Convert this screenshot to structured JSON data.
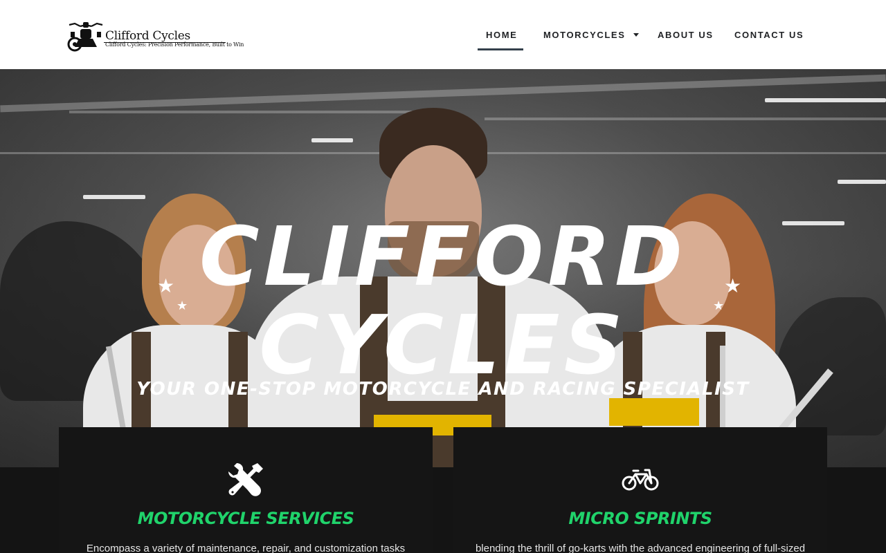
{
  "brand": {
    "logo_title": "Clifford Cycles",
    "logo_tagline": "Clifford Cycles: Precision Performance, Built to Win"
  },
  "nav": {
    "items": [
      {
        "label": "HOME",
        "active": true
      },
      {
        "label": "MOTORCYCLES",
        "has_dropdown": true
      },
      {
        "label": "ABOUT US"
      },
      {
        "label": "CONTACT US"
      }
    ]
  },
  "hero": {
    "title_line1": "CLIFFORD",
    "title_line2": "CYCLES",
    "subtitle": "YOUR ONE-STOP MOTORCYCLE AND RACING SPECIALIST",
    "star_icon": "★"
  },
  "cards": [
    {
      "icon": "tools-icon",
      "title": "MOTORCYCLE SERVICES",
      "text": "Encompass a variety of maintenance, repair, and customization tasks"
    },
    {
      "icon": "bicycle-icon",
      "title": "MICRO SPRINTS",
      "text": "blending the thrill of go-karts with the advanced engineering of full-sized"
    }
  ],
  "colors": {
    "accent_green": "#20d36b",
    "card_bg": "#151515",
    "nav_underline": "#34404b",
    "overall_brown": "#4a3a2c",
    "pocket_yellow": "#e2b400"
  }
}
